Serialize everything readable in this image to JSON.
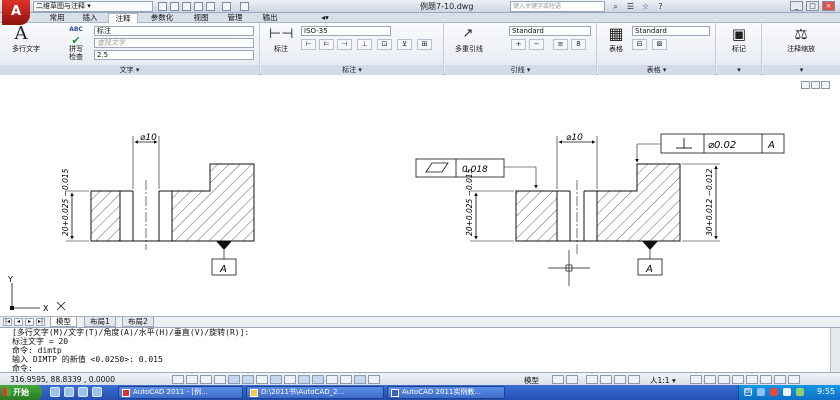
{
  "titlebar": {
    "app_logo": "A",
    "workspace": "二维草图与注释",
    "document_title": "例题7-10.dwg",
    "search_placeholder": "键入关键字或短语",
    "window_buttons": [
      "_",
      "□",
      "×"
    ]
  },
  "ribbon_tabs": [
    {
      "label": "常用",
      "active": false
    },
    {
      "label": "插入",
      "active": false
    },
    {
      "label": "注释",
      "active": true
    },
    {
      "label": "参数化",
      "active": false
    },
    {
      "label": "视图",
      "active": false
    },
    {
      "label": "管理",
      "active": false
    },
    {
      "label": "输出",
      "active": false
    }
  ],
  "ribbon": {
    "text_panel": {
      "title": "文字",
      "mtext_label": "多行文字",
      "spell_label": "拼写\n检查",
      "spell_badge": "ABC",
      "style_value": "标注",
      "find_placeholder": "查找文字",
      "height_value": "2.5"
    },
    "dim_panel": {
      "title": "标注",
      "dim_label": "标注",
      "dim_style": "ISO-35"
    },
    "leader_panel": {
      "title": "引线",
      "mleader_label": "多重引线",
      "leader_style": "Standard"
    },
    "table_panel": {
      "title": "表格",
      "table_label": "表格",
      "table_style": "Standard"
    },
    "markup_panel": {
      "label": "标记"
    },
    "scale_panel": {
      "label": "注释缩放"
    }
  },
  "drawing": {
    "left_diameter": "⌀10",
    "left_side_dim": "20+0.025 −0.015",
    "left_datum": "A",
    "right_diameter": "⌀10",
    "right_side_dim": "20+0.025 −0.015",
    "right_height_dim": "30+0.012 −0.012",
    "right_datum": "A",
    "flatness_value": "0.018",
    "perp_tolerance": "⌀0.02",
    "perp_datum": "A",
    "ucs_y": "Y",
    "ucs_x": "X"
  },
  "layout_tabs": [
    {
      "label": "模型",
      "active": true
    },
    {
      "label": "布局1",
      "active": false
    },
    {
      "label": "布局2",
      "active": false
    }
  ],
  "command_lines": [
    "[多行文字(M)/文字(T)/角度(A)/水平(H)/垂直(V)/旋转(R)]:",
    "标注文字 = 20",
    "命令: dimtp",
    "输入 DIMTP 的新值 <0.0250>: 0.015",
    "命令:"
  ],
  "status": {
    "coords": "316.9595, 88.8339 , 0.0000",
    "model": "模型",
    "scale": "人1:1 ▾"
  },
  "taskbar": {
    "start_label": "开始",
    "tasks": [
      "AutoCAD 2011 - [例...",
      "D:\\2011书\\AutoCAD_2...",
      "AutoCAD 2011实例教..."
    ],
    "tray_lang": "EN",
    "clock": "9:55"
  },
  "colors": {
    "ribbon_bg": "#e4e9f0",
    "taskbar": "#2b5bc0",
    "start": "#3a9430",
    "app_logo": "#c8261d"
  }
}
